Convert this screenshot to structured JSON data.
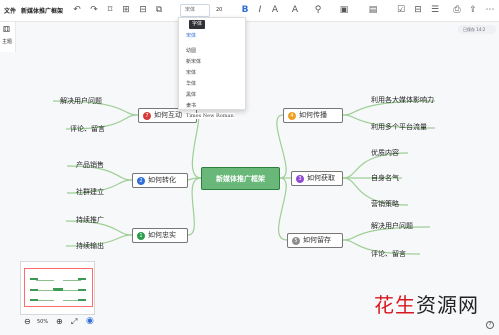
{
  "toolbar": {
    "file_label": "文件",
    "doc_title": "新媒体推广框架",
    "font_value": "宋体",
    "size_value": "20"
  },
  "left_panel": {
    "theme_label": "主题"
  },
  "font_dropdown": {
    "tooltip": "字体",
    "items": [
      "宋体",
      "幼圆",
      "新宋体",
      "宋体",
      "华体",
      "黑体",
      "隶书",
      "Times New Roman"
    ]
  },
  "status": {
    "text": "已保存 14:2"
  },
  "mindmap": {
    "center": "新媒体推广框架",
    "branches": [
      {
        "label": "如何互动",
        "badge": "7",
        "color": "#d93b3b",
        "children": [
          "解决用户问题",
          "评论、留言"
        ]
      },
      {
        "label": "如何转化",
        "badge": "2",
        "color": "#2f6fd6",
        "children": [
          "产品销售",
          "社群建立"
        ]
      },
      {
        "label": "如何忠实",
        "badge": "1",
        "color": "#2d9c4c",
        "children": [
          "持续推广",
          "持续输出"
        ]
      },
      {
        "label": "如何传播",
        "badge": "4",
        "color": "#f0a020",
        "children": [
          "利用各大媒体影响力",
          "利用多个平台流量"
        ]
      },
      {
        "label": "如何获取",
        "badge": "3",
        "color": "#8e4ad2",
        "children": [
          "优质内容",
          "自身名气",
          "营销策略"
        ]
      },
      {
        "label": "如何留存",
        "badge": "5",
        "color": "#8d8d8d",
        "children": [
          "解决用户问题",
          "评论、留言"
        ]
      }
    ]
  },
  "zoom": {
    "level": "50%"
  },
  "watermark": {
    "text1": "花",
    "text2": "生",
    "text3": "资",
    "text4": "源",
    "text5": "网"
  }
}
